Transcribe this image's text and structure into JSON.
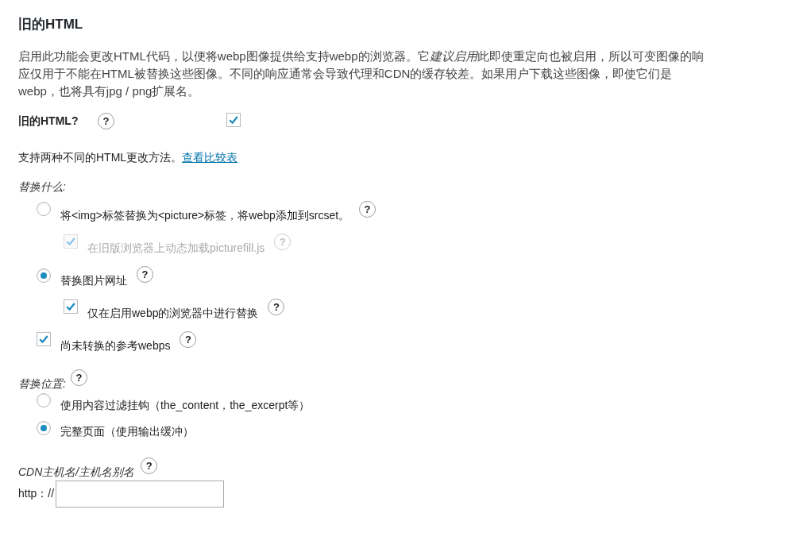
{
  "title": "旧的HTML",
  "description": {
    "before": "启用此功能会更改HTML代码，以便将webp图像提供给支持webp的浏览器。它",
    "emphasis": "建议启用",
    "after": "此即使重定向也被启用，所以可变图像的响应仅用于不能在HTML被替换这些图像。不同的响应通常会导致代理和CDN的缓存较差。如果用户下载这些图像，即使它们是webp，也将具有jpg / png扩展名。"
  },
  "enable": {
    "label": "旧的HTML?",
    "help": "?",
    "checked": true
  },
  "methods_note": {
    "text": "支持两种不同的HTML更改方法。",
    "link": "查看比较表"
  },
  "what": {
    "label": "替换什么:",
    "options": [
      {
        "kind": "radio",
        "label": "将<img>标签替换为<picture>标签，将webp添加到srcset。",
        "help": "?",
        "selected": false,
        "children": [
          {
            "kind": "checkbox",
            "label": "在旧版浏览器上动态加载picturefill.js",
            "help": "?",
            "checked": true,
            "disabled": true
          }
        ]
      },
      {
        "kind": "radio",
        "label": "替换图片网址",
        "help": "?",
        "selected": true,
        "children": [
          {
            "kind": "checkbox",
            "label": "仅在启用webp的浏览器中进行替换",
            "help": "?",
            "checked": true,
            "disabled": false
          }
        ]
      },
      {
        "kind": "checkbox",
        "label": "尚未转换的参考webps",
        "help": "?",
        "checked": true,
        "disabled": false
      }
    ]
  },
  "where": {
    "label": "替换位置:",
    "help": "?",
    "options": [
      {
        "label": "使用内容过滤挂钩（the_content，the_excerpt等）",
        "selected": false
      },
      {
        "label": "完整页面（使用输出缓冲）",
        "selected": true
      }
    ]
  },
  "cdn": {
    "label": "CDN主机名/主机名别名",
    "help": "?",
    "prefix": "http：//"
  }
}
